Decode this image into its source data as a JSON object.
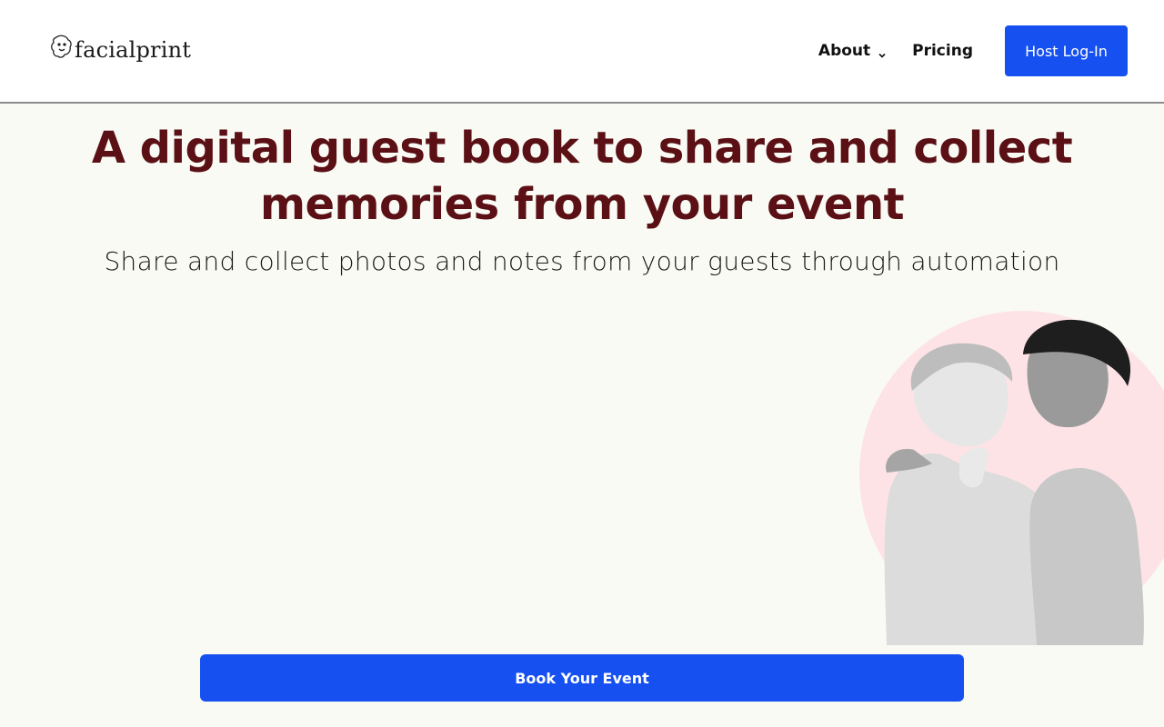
{
  "brand": {
    "name": "facialprint"
  },
  "nav": {
    "about_label": "About",
    "pricing_label": "Pricing",
    "login_label": "Host Log-In"
  },
  "hero": {
    "title": "A digital guest book to share and collect memories from your event",
    "subtitle": "Share and collect photos and notes from your guests through automation",
    "cta_label": "Book Your Event"
  },
  "colors": {
    "accent": "#1650f0",
    "title": "#5a1014",
    "background": "#fafaf5",
    "circle": "#fde3e6"
  },
  "icons": {
    "logo": "face-outline-icon",
    "about_dropdown": "chevron-down-icon"
  }
}
